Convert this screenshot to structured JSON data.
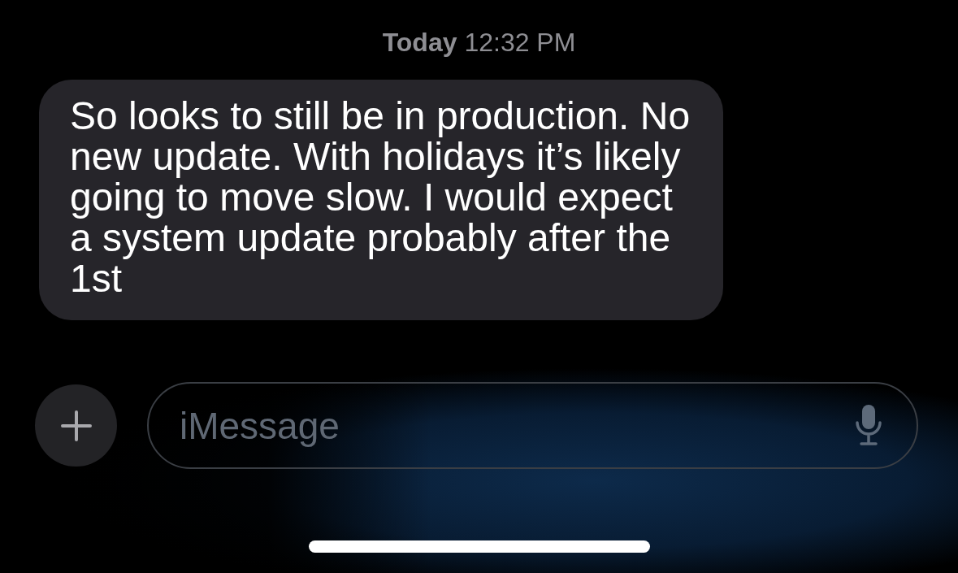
{
  "timestamp": "**Today** 12:32 PM",
  "messages": [
    {
      "text": "So looks to still be in production. No new update. With holidays it’s likely going to move slow. I would expect a system update probably after the 1st",
      "kind": "received"
    }
  ],
  "composer": {
    "placeholder": "iMessage"
  }
}
